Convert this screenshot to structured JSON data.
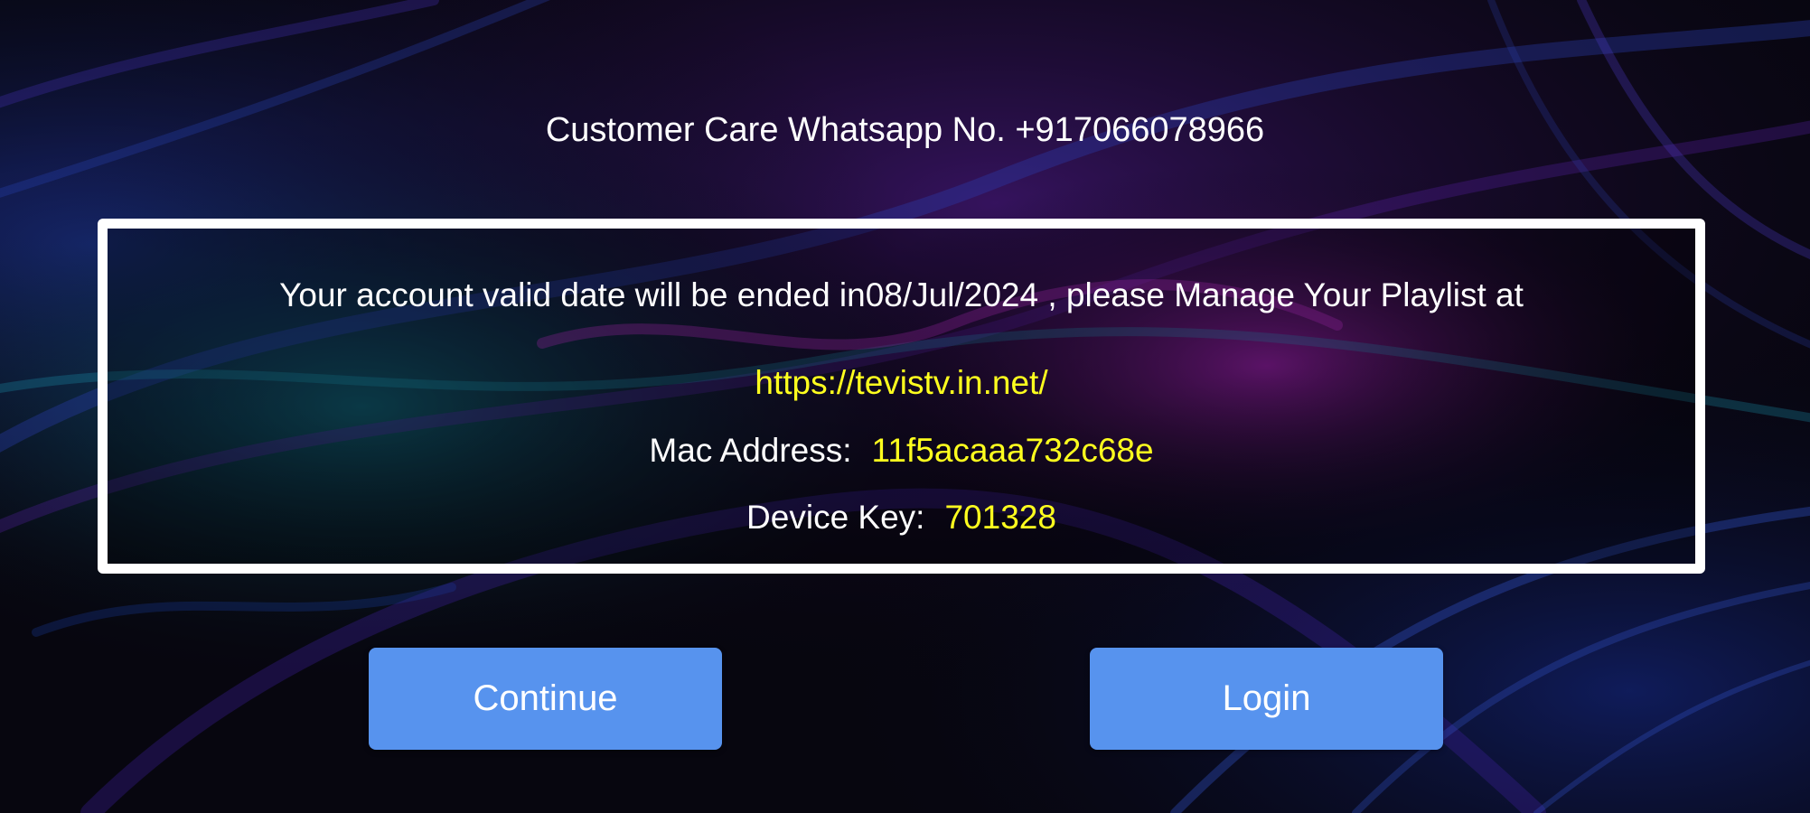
{
  "support": {
    "text": "Customer Care Whatsapp No. +917066078966"
  },
  "dialog": {
    "notice": "Your account valid date will be ended in08/Jul/2024 , please Manage Your Playlist at",
    "url": "https://tevistv.in.net/",
    "mac_label": "Mac Address:",
    "mac_value": "11f5acaaa732c68e",
    "device_key_label": "Device Key:",
    "device_key_value": "701328"
  },
  "buttons": {
    "continue_label": "Continue",
    "login_label": "Login"
  },
  "colors": {
    "background": "#07060f",
    "box_border": "#ffffff",
    "highlight_text": "#ffff1e",
    "button": "#5793ee"
  }
}
